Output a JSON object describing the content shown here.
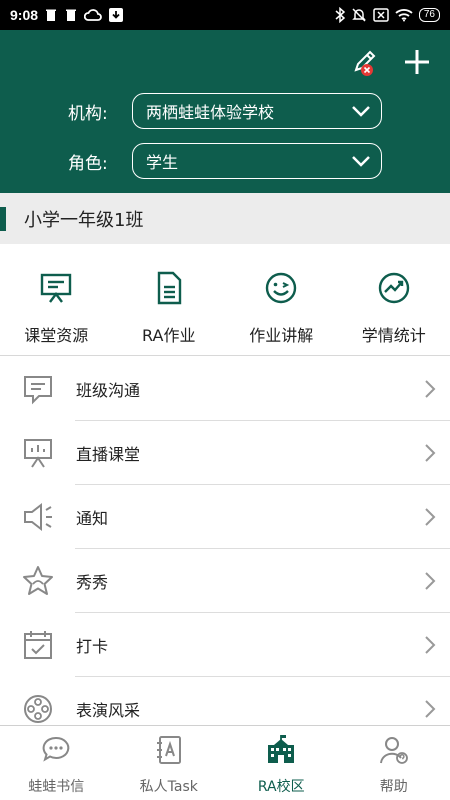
{
  "status_bar": {
    "time": "9:08",
    "battery": "76"
  },
  "header": {
    "org_label": "机构:",
    "org_value": "两栖蛙蛙体验学校",
    "role_label": "角色:",
    "role_value": "学生",
    "background_color": "#0e5d4d"
  },
  "class_bar": {
    "title": "小学一年级1班"
  },
  "quick_actions": [
    {
      "label": "课堂资源",
      "icon": "presentation-board-icon"
    },
    {
      "label": "RA作业",
      "icon": "document-icon"
    },
    {
      "label": "作业讲解",
      "icon": "wink-face-icon"
    },
    {
      "label": "学情统计",
      "icon": "trend-chart-icon"
    }
  ],
  "menu": [
    {
      "label": "班级沟通",
      "icon": "chat-bubble-icon"
    },
    {
      "label": "直播课堂",
      "icon": "live-board-icon"
    },
    {
      "label": "通知",
      "icon": "speaker-icon"
    },
    {
      "label": "秀秀",
      "icon": "star-icon"
    },
    {
      "label": "打卡",
      "icon": "calendar-check-icon"
    },
    {
      "label": "表演风采",
      "icon": "film-reel-icon"
    }
  ],
  "bottom_nav": [
    {
      "label": "蛙蛙书信",
      "icon": "chat-icon",
      "active": false
    },
    {
      "label": "私人Task",
      "icon": "notebook-icon",
      "active": false
    },
    {
      "label": "RA校区",
      "icon": "school-icon",
      "active": true
    },
    {
      "label": "帮助",
      "icon": "help-user-icon",
      "active": false
    }
  ],
  "colors": {
    "accent": "#0e5d4d",
    "icon_gray": "#888888",
    "danger": "#e53935"
  }
}
